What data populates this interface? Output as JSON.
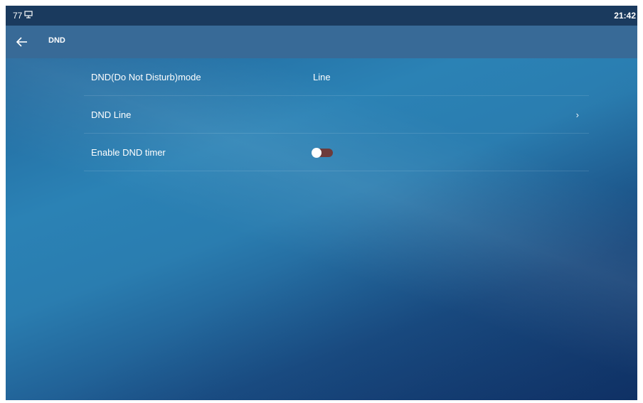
{
  "statusbar": {
    "left_text": "77",
    "left_icon": "network-icon",
    "time": "21:42"
  },
  "navbar": {
    "back_icon": "arrow-left-icon",
    "title": "DND"
  },
  "settings": [
    {
      "label": "DND(Do Not Disturb)mode",
      "value": "Line"
    },
    {
      "label": "DND Line",
      "value": "",
      "chevron": "›"
    },
    {
      "label": "Enable DND timer",
      "toggle_state": "off"
    }
  ],
  "colors": {
    "statusbar_bg": "#1a3a5e",
    "navbar_bg": "#386a97",
    "toggle_track_off": "#6d3b3b",
    "background_gradient": [
      "#1d5d93",
      "#2b82b5",
      "#143a72"
    ]
  }
}
